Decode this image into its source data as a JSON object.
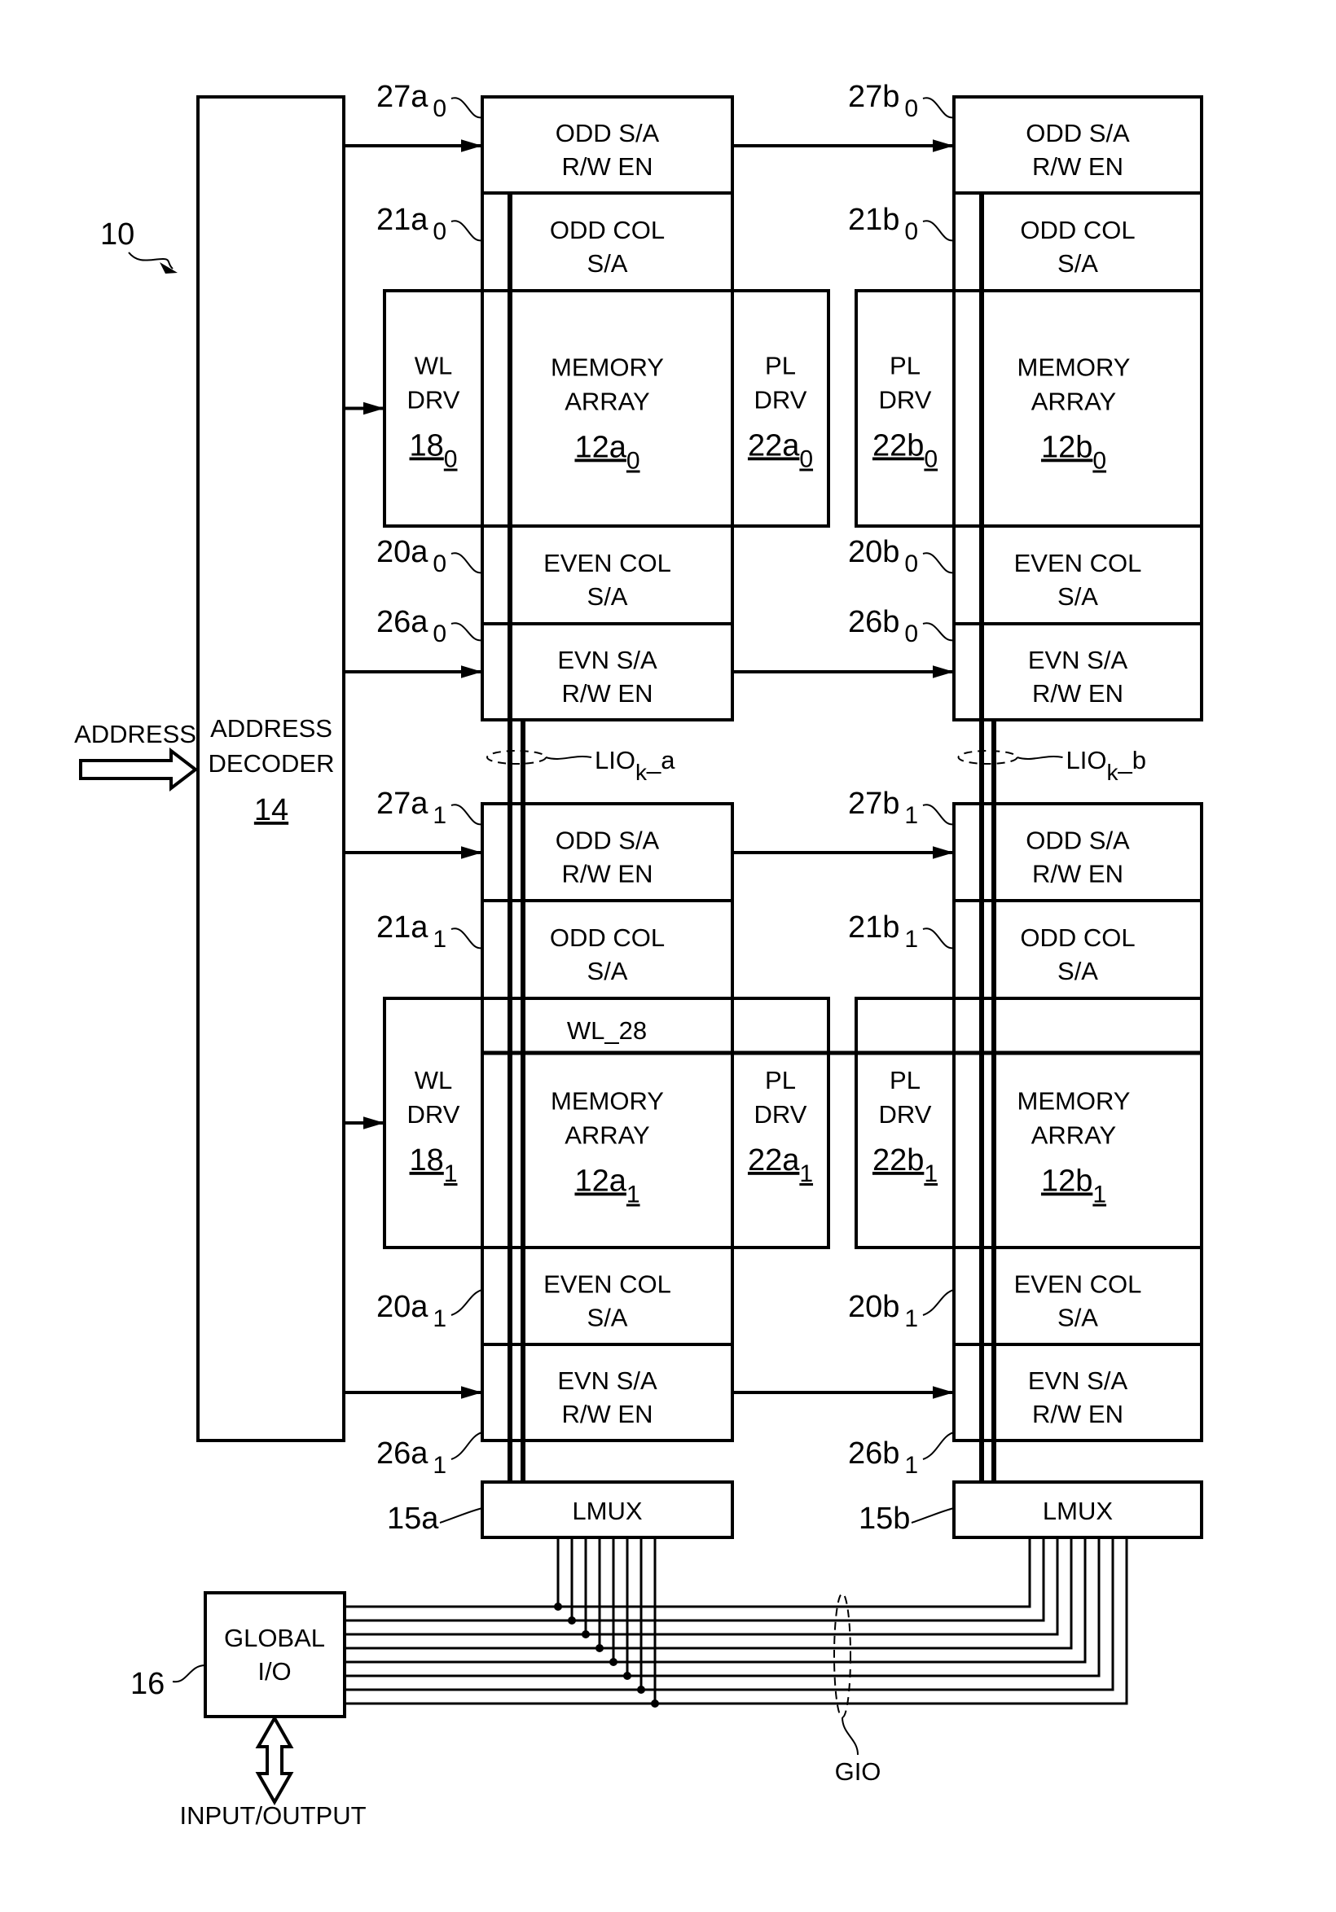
{
  "figure": {
    "ref_main": "10",
    "input_label": "ADDRESS",
    "decoder": {
      "line1": "ADDRESS",
      "line2": "DECODER",
      "ref": "14"
    },
    "global_io": {
      "line1": "GLOBAL",
      "line2": "I/O",
      "ref": "16",
      "io_label": "INPUT/OUTPUT"
    },
    "gio_label": "GIO",
    "gio_line_count": 8,
    "lio": [
      {
        "base": "LIO",
        "sub": "k",
        "suffix": "_a"
      },
      {
        "base": "LIO",
        "sub": "k",
        "suffix": "_b"
      }
    ],
    "wl_line_label": "WL_28",
    "lmux": [
      {
        "label": "LMUX",
        "ref": "15a"
      },
      {
        "label": "LMUX",
        "ref": "15b"
      }
    ],
    "blocks": {
      "odd_sa_rw": [
        "ODD S/A",
        "R/W EN"
      ],
      "odd_col": [
        "ODD COL",
        "S/A"
      ],
      "memory": [
        "MEMORY",
        "ARRAY"
      ],
      "even_col": [
        "EVEN COL",
        "S/A"
      ],
      "evn_sa_rw": [
        "EVN S/A",
        "R/W EN"
      ],
      "wl_drv": [
        "WL",
        "DRV"
      ],
      "pl_drv": [
        "PL",
        "DRV"
      ]
    },
    "columns": [
      {
        "tiles": [
          {
            "sub": "0",
            "r27": "27a",
            "r21": "21a",
            "r20": "20a",
            "r26": "26a",
            "mem": "12a",
            "wl": "18",
            "pl": "22a"
          },
          {
            "sub": "1",
            "r27": "27a",
            "r21": "21a",
            "r20": "20a",
            "r26": "26a",
            "mem": "12a",
            "wl": "18",
            "pl": "22a"
          }
        ]
      },
      {
        "tiles": [
          {
            "sub": "0",
            "r27": "27b",
            "r21": "21b",
            "r20": "20b",
            "r26": "26b",
            "mem": "12b",
            "pl": "22b"
          },
          {
            "sub": "1",
            "r27": "27b",
            "r21": "21b",
            "r20": "20b",
            "r26": "26b",
            "mem": "12b",
            "pl": "22b"
          }
        ]
      }
    ]
  }
}
